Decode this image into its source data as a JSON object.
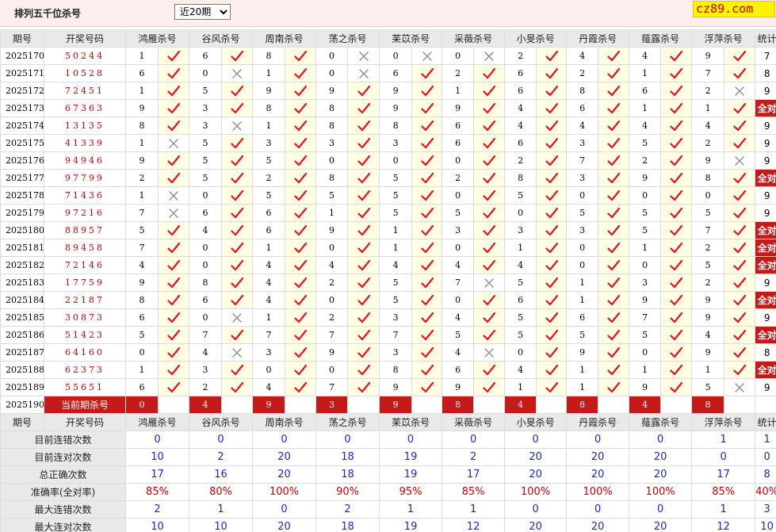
{
  "title": "排列五千位杀号",
  "period_select": {
    "value": "近20期",
    "options": [
      "近20期"
    ]
  },
  "logo": "cz89.com",
  "columns": [
    "期号",
    "开奖号码",
    "鸿雁杀号",
    "谷风杀号",
    "周南杀号",
    "荡之杀号",
    "苿苡杀号",
    "采薇杀号",
    "小旻杀号",
    "丹霞杀号",
    "薤露杀号",
    "浮萍杀号",
    "统计"
  ],
  "rows": [
    {
      "issue": "2025170",
      "draw": "50244",
      "kills": [
        1,
        6,
        8,
        0,
        0,
        0,
        2,
        4,
        4,
        9
      ],
      "ok": [
        1,
        1,
        1,
        0,
        0,
        0,
        1,
        1,
        1,
        1
      ],
      "stat": "7"
    },
    {
      "issue": "2025171",
      "draw": "10528",
      "kills": [
        6,
        0,
        1,
        0,
        6,
        2,
        6,
        2,
        1,
        7
      ],
      "ok": [
        1,
        0,
        1,
        0,
        1,
        1,
        1,
        1,
        1,
        1
      ],
      "stat": "8"
    },
    {
      "issue": "2025172",
      "draw": "72451",
      "kills": [
        1,
        5,
        9,
        9,
        9,
        1,
        6,
        8,
        6,
        2
      ],
      "ok": [
        1,
        1,
        1,
        1,
        1,
        1,
        1,
        1,
        1,
        0
      ],
      "stat": "9"
    },
    {
      "issue": "2025173",
      "draw": "67363",
      "kills": [
        9,
        3,
        8,
        8,
        9,
        9,
        4,
        6,
        1,
        1
      ],
      "ok": [
        1,
        1,
        1,
        1,
        1,
        1,
        1,
        1,
        1,
        1
      ],
      "stat": "全对"
    },
    {
      "issue": "2025174",
      "draw": "13135",
      "kills": [
        8,
        3,
        1,
        8,
        8,
        6,
        4,
        4,
        4,
        4
      ],
      "ok": [
        1,
        0,
        1,
        1,
        1,
        1,
        1,
        1,
        1,
        1
      ],
      "stat": "9"
    },
    {
      "issue": "2025175",
      "draw": "41339",
      "kills": [
        1,
        5,
        3,
        3,
        3,
        6,
        6,
        3,
        5,
        2
      ],
      "ok": [
        0,
        1,
        1,
        1,
        1,
        1,
        1,
        1,
        1,
        1
      ],
      "stat": "9"
    },
    {
      "issue": "2025176",
      "draw": "94946",
      "kills": [
        9,
        5,
        5,
        0,
        0,
        0,
        2,
        7,
        2,
        9
      ],
      "ok": [
        1,
        1,
        1,
        1,
        1,
        1,
        1,
        1,
        1,
        0
      ],
      "stat": "9"
    },
    {
      "issue": "2025177",
      "draw": "97799",
      "kills": [
        2,
        5,
        2,
        8,
        5,
        2,
        8,
        3,
        9,
        8
      ],
      "ok": [
        1,
        1,
        1,
        1,
        1,
        1,
        1,
        1,
        1,
        1
      ],
      "stat": "全对"
    },
    {
      "issue": "2025178",
      "draw": "71436",
      "kills": [
        1,
        0,
        5,
        5,
        5,
        0,
        5,
        0,
        0,
        0
      ],
      "ok": [
        0,
        1,
        1,
        1,
        1,
        1,
        1,
        1,
        1,
        1
      ],
      "stat": "9"
    },
    {
      "issue": "2025179",
      "draw": "97216",
      "kills": [
        7,
        6,
        6,
        1,
        5,
        5,
        0,
        5,
        5,
        5
      ],
      "ok": [
        0,
        1,
        1,
        1,
        1,
        1,
        1,
        1,
        1,
        1
      ],
      "stat": "9"
    },
    {
      "issue": "2025180",
      "draw": "88957",
      "kills": [
        5,
        4,
        6,
        9,
        1,
        3,
        3,
        3,
        5,
        7
      ],
      "ok": [
        1,
        1,
        1,
        1,
        1,
        1,
        1,
        1,
        1,
        1
      ],
      "stat": "全对"
    },
    {
      "issue": "2025181",
      "draw": "89458",
      "kills": [
        7,
        0,
        1,
        0,
        1,
        0,
        1,
        0,
        1,
        2
      ],
      "ok": [
        1,
        1,
        1,
        1,
        1,
        1,
        1,
        1,
        1,
        1
      ],
      "stat": "全对"
    },
    {
      "issue": "2025182",
      "draw": "72146",
      "kills": [
        4,
        0,
        4,
        4,
        4,
        4,
        4,
        0,
        0,
        5
      ],
      "ok": [
        1,
        1,
        1,
        1,
        1,
        1,
        1,
        1,
        1,
        1
      ],
      "stat": "全对"
    },
    {
      "issue": "2025183",
      "draw": "17759",
      "kills": [
        9,
        8,
        4,
        2,
        5,
        7,
        5,
        1,
        3,
        2
      ],
      "ok": [
        1,
        1,
        1,
        1,
        1,
        0,
        1,
        1,
        1,
        1
      ],
      "stat": "9"
    },
    {
      "issue": "2025184",
      "draw": "22187",
      "kills": [
        8,
        6,
        4,
        0,
        5,
        0,
        6,
        1,
        9,
        9
      ],
      "ok": [
        1,
        1,
        1,
        1,
        1,
        1,
        1,
        1,
        1,
        1
      ],
      "stat": "全对"
    },
    {
      "issue": "2025185",
      "draw": "30873",
      "kills": [
        6,
        0,
        1,
        2,
        3,
        4,
        5,
        6,
        7,
        9
      ],
      "ok": [
        1,
        0,
        1,
        1,
        1,
        1,
        1,
        1,
        1,
        1
      ],
      "stat": "9"
    },
    {
      "issue": "2025186",
      "draw": "51423",
      "kills": [
        5,
        7,
        7,
        7,
        7,
        5,
        5,
        5,
        5,
        4
      ],
      "ok": [
        1,
        1,
        1,
        1,
        1,
        1,
        1,
        1,
        1,
        1
      ],
      "stat": "全对"
    },
    {
      "issue": "2025187",
      "draw": "64160",
      "kills": [
        0,
        4,
        3,
        9,
        3,
        4,
        0,
        9,
        0,
        9
      ],
      "ok": [
        1,
        0,
        1,
        1,
        1,
        0,
        1,
        1,
        1,
        1
      ],
      "stat": "8"
    },
    {
      "issue": "2025188",
      "draw": "62373",
      "kills": [
        1,
        3,
        0,
        0,
        8,
        6,
        4,
        1,
        1,
        1
      ],
      "ok": [
        1,
        1,
        1,
        1,
        1,
        1,
        1,
        1,
        1,
        1
      ],
      "stat": "全对"
    },
    {
      "issue": "2025189",
      "draw": "55651",
      "kills": [
        6,
        2,
        4,
        7,
        9,
        9,
        1,
        1,
        9,
        5
      ],
      "ok": [
        1,
        1,
        1,
        1,
        1,
        1,
        1,
        1,
        1,
        0
      ],
      "stat": "9"
    }
  ],
  "current": {
    "issue": "2025190",
    "label": "当前期杀号",
    "kills": [
      0,
      4,
      9,
      3,
      9,
      8,
      4,
      8,
      4,
      8
    ]
  },
  "summary": [
    {
      "label": "目前连错次数",
      "values": [
        "0",
        "0",
        "0",
        "0",
        "0",
        "0",
        "0",
        "0",
        "0",
        "1"
      ],
      "stat": "1",
      "red": false
    },
    {
      "label": "目前连对次数",
      "values": [
        "10",
        "2",
        "20",
        "18",
        "19",
        "2",
        "20",
        "20",
        "20",
        "0"
      ],
      "stat": "0",
      "red": false
    },
    {
      "label": "总正确次数",
      "values": [
        "17",
        "16",
        "20",
        "18",
        "19",
        "17",
        "20",
        "20",
        "20",
        "17"
      ],
      "stat": "8",
      "red": false
    },
    {
      "label": "准确率(全对率)",
      "values": [
        "85%",
        "80%",
        "100%",
        "90%",
        "95%",
        "85%",
        "100%",
        "100%",
        "100%",
        "85%"
      ],
      "stat": "40%",
      "red": true
    },
    {
      "label": "最大连错次数",
      "values": [
        "2",
        "1",
        "0",
        "2",
        "1",
        "1",
        "0",
        "0",
        "0",
        "1"
      ],
      "stat": "3",
      "red": false
    },
    {
      "label": "最大连对次数",
      "values": [
        "10",
        "10",
        "20",
        "18",
        "19",
        "12",
        "20",
        "20",
        "20",
        "12"
      ],
      "stat": "10",
      "red": false
    }
  ],
  "colors": {
    "correct": "#e8141b",
    "wrong": "#8a8a8a",
    "highlight": "#c41a1a",
    "summary_value": "#1a2bb8"
  },
  "icons": {
    "correct": "check-icon",
    "wrong": "cross-icon"
  }
}
